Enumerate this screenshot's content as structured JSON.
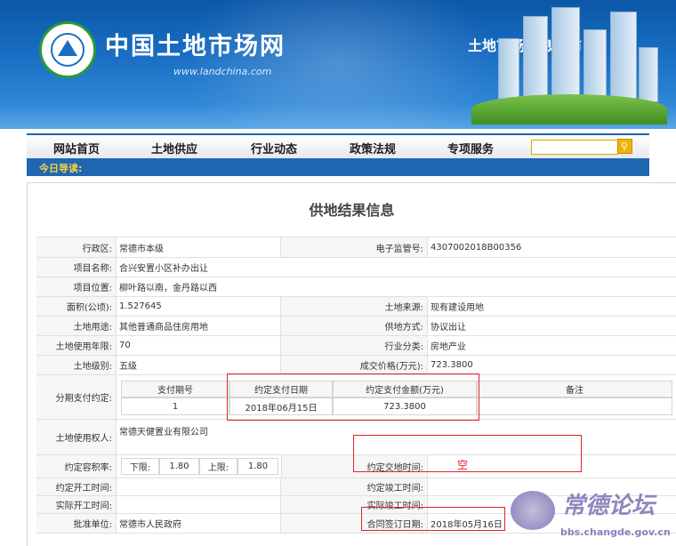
{
  "header": {
    "site_title": "中国土地市场网",
    "site_url": "www.landchina.com",
    "slogan": "土地市场信息发布"
  },
  "nav": {
    "items": [
      "网站首页",
      "土地供应",
      "行业动态",
      "政策法规",
      "专项服务"
    ],
    "search_value": "",
    "guide_label": "今日导读:"
  },
  "page": {
    "title": "供地结果信息",
    "fields": {
      "district_label": "行政区:",
      "district": "常德市本级",
      "supervision_label": "电子监管号:",
      "supervision": "4307002018B00356",
      "project_name_label": "项目名称:",
      "project_name": "合兴安置小区补办出让",
      "location_label": "项目位置:",
      "location": "柳叶路以南，金丹路以西",
      "area_label": "面积(公顷):",
      "area": "1.527645",
      "source_label": "土地来源:",
      "source": "现有建设用地",
      "use_label": "土地用途:",
      "use": "其他普通商品住房用地",
      "supply_label": "供地方式:",
      "supply": "协议出让",
      "term_label": "土地使用年限:",
      "term": "70",
      "industry_label": "行业分类:",
      "industry": "房地产业",
      "level_label": "土地级别:",
      "level": "五级",
      "price_label": "成交价格(万元):",
      "price": "723.3800",
      "installment_label": "分期支付约定:",
      "user_label": "土地使用权人:",
      "user": "常德天健置业有限公司",
      "far_label": "约定容积率:",
      "far_lower_label": "下限:",
      "far_lower": "1.80",
      "far_upper_label": "上限:",
      "far_upper": "1.80",
      "delivery_label": "约定交地时间:",
      "delivery": "空",
      "start_label": "约定开工时间:",
      "start": "",
      "finish_label": "约定竣工时间:",
      "finish": "",
      "actual_start_label": "实际开工时间:",
      "actual_start": "",
      "actual_finish_label": "实际竣工时间:",
      "actual_finish": "",
      "approver_label": "批准单位:",
      "approver": "常德市人民政府",
      "sign_label": "合同签订日期:",
      "sign": "2018年05月16日"
    },
    "installment": {
      "headers": [
        "支付期号",
        "约定支付日期",
        "约定支付金额(万元)",
        "备注"
      ],
      "rows": [
        [
          "1",
          "2018年06月15日",
          "723.3800",
          ""
        ]
      ]
    }
  },
  "watermark": {
    "text": "常德论坛",
    "url": "bbs.changde.gov.cn"
  },
  "colors": {
    "nav_accent": "#1f67b1",
    "highlight": "#e0242e"
  }
}
